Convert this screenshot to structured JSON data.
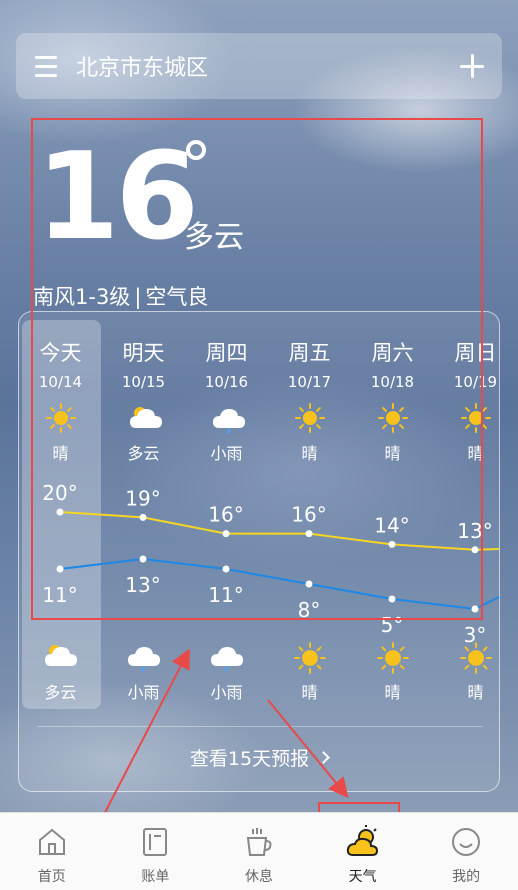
{
  "header": {
    "location": "北京市东城区"
  },
  "current": {
    "temperature": "16",
    "condition": "多云",
    "wind": "南风1-3级",
    "separator": "|",
    "air_quality": "空气良"
  },
  "forecast": {
    "days": [
      {
        "day": "今天",
        "date": "10/14",
        "cond_day": "晴",
        "icon_day": "sun-icon",
        "high": "20°",
        "low": "11°",
        "cond_night": "多云",
        "icon_night": "partly-cloudy-icon"
      },
      {
        "day": "明天",
        "date": "10/15",
        "cond_day": "多云",
        "icon_day": "partly-cloudy-icon",
        "high": "19°",
        "low": "13°",
        "cond_night": "小雨",
        "icon_night": "light-rain-icon"
      },
      {
        "day": "周四",
        "date": "10/16",
        "cond_day": "小雨",
        "icon_day": "light-rain-icon",
        "high": "16°",
        "low": "11°",
        "cond_night": "小雨",
        "icon_night": "light-rain-icon"
      },
      {
        "day": "周五",
        "date": "10/17",
        "cond_day": "晴",
        "icon_day": "sun-icon",
        "high": "16°",
        "low": "8°",
        "cond_night": "晴",
        "icon_night": "sun-icon"
      },
      {
        "day": "周六",
        "date": "10/18",
        "cond_day": "晴",
        "icon_day": "sun-icon",
        "high": "14°",
        "low": "5°",
        "cond_night": "晴",
        "icon_night": "sun-icon"
      },
      {
        "day": "周日",
        "date": "10/19",
        "cond_day": "晴",
        "icon_day": "sun-icon",
        "high": "13°",
        "low": "3°",
        "cond_night": "晴",
        "icon_night": "sun-icon"
      }
    ],
    "high_values": [
      20,
      19,
      16,
      16,
      14,
      13
    ],
    "low_values": [
      11,
      13,
      11,
      8,
      5,
      3
    ],
    "high_color": "#f5d623",
    "low_color": "#1e88e5",
    "more_label": "查看15天预报"
  },
  "tabbar": {
    "items": [
      {
        "label": "首页",
        "icon": "home-icon"
      },
      {
        "label": "账单",
        "icon": "bill-icon"
      },
      {
        "label": "休息",
        "icon": "coffee-icon"
      },
      {
        "label": "天气",
        "icon": "weather-icon"
      },
      {
        "label": "我的",
        "icon": "smile-icon"
      }
    ],
    "active_index": 3
  },
  "colors": {
    "annotation": "#e84a4a"
  }
}
